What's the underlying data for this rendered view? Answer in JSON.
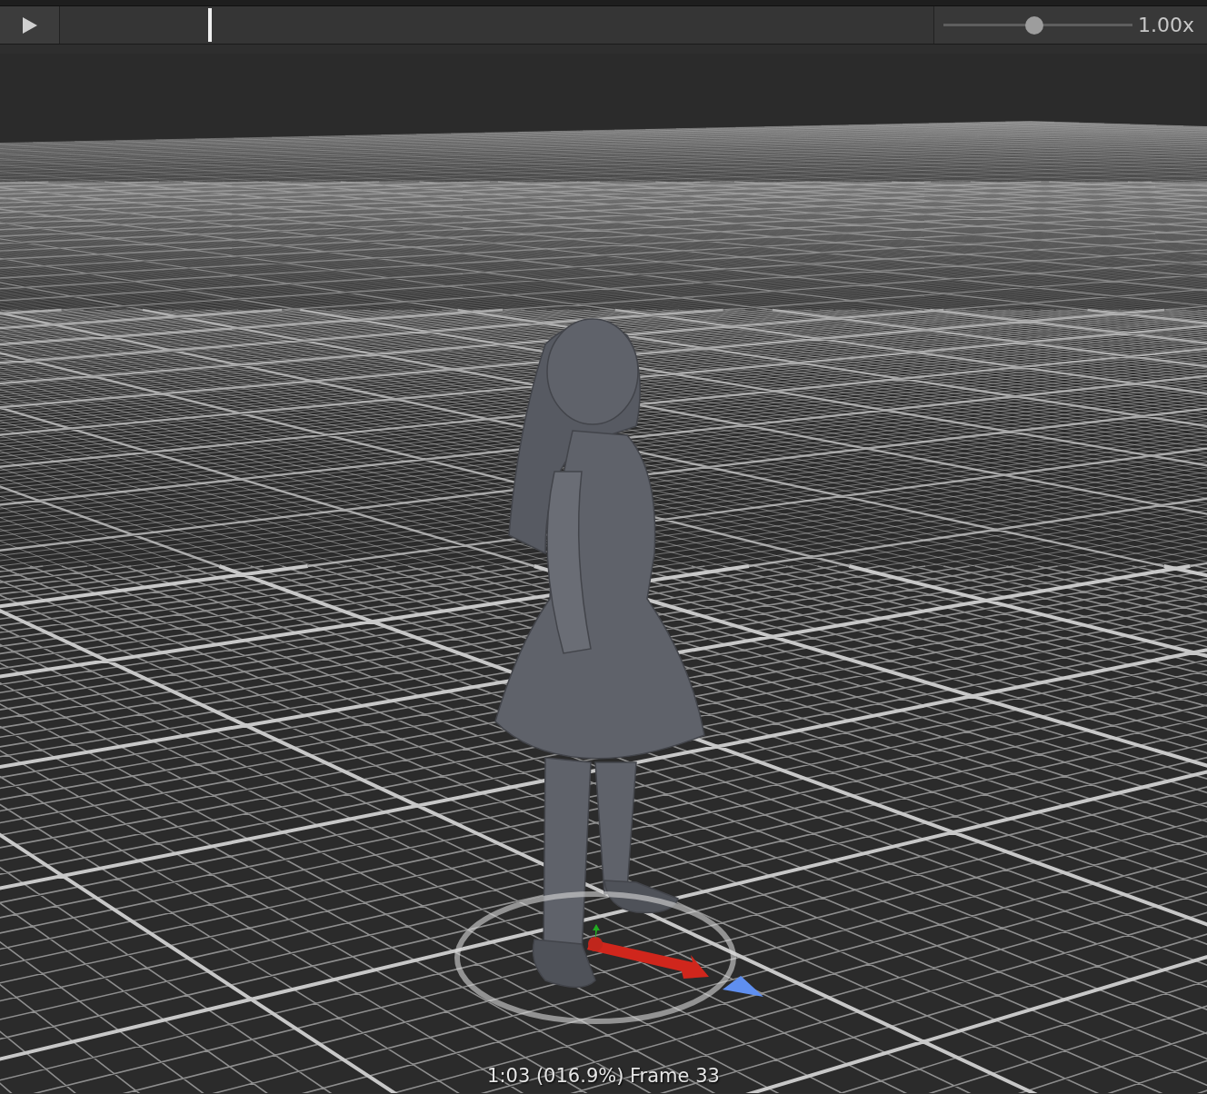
{
  "timeline": {
    "level": 0.172
  },
  "speed": {
    "level": 0.48,
    "reading": "1.00x"
  },
  "viewport": {
    "status": "1:03 (016.9%) Frame 33"
  }
}
